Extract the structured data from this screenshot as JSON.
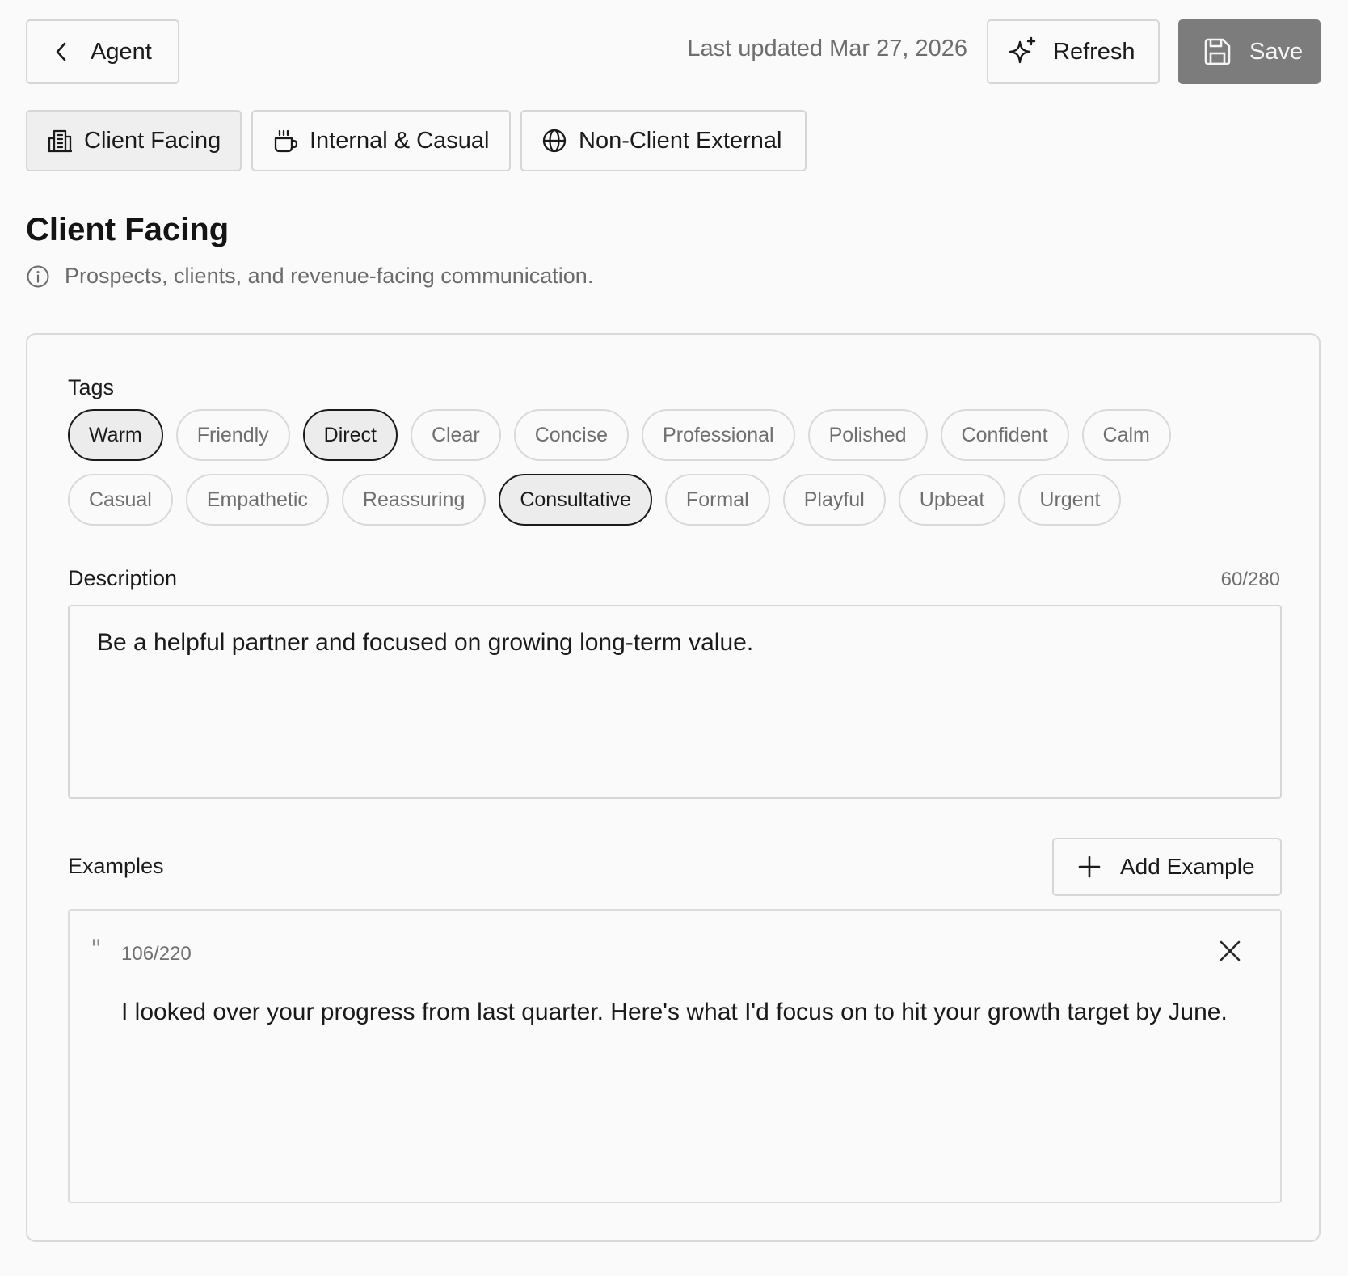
{
  "header": {
    "back_label": "Agent",
    "last_updated": "Last updated Mar 27, 2026",
    "refresh_label": "Refresh",
    "save_label": "Save"
  },
  "tabs": [
    {
      "label": "Client Facing",
      "icon": "building-icon",
      "active": true
    },
    {
      "label": "Internal & Casual",
      "icon": "coffee-cup-icon",
      "active": false
    },
    {
      "label": "Non-Client External",
      "icon": "globe-icon",
      "active": false
    }
  ],
  "section": {
    "title": "Client Facing",
    "subtitle": "Prospects, clients, and revenue-facing communication."
  },
  "tags": {
    "label": "Tags",
    "rows": [
      [
        {
          "label": "Warm",
          "selected": true
        },
        {
          "label": "Friendly",
          "selected": false
        },
        {
          "label": "Direct",
          "selected": true
        },
        {
          "label": "Clear",
          "selected": false
        },
        {
          "label": "Concise",
          "selected": false
        },
        {
          "label": "Professional",
          "selected": false
        },
        {
          "label": "Polished",
          "selected": false
        },
        {
          "label": "Confident",
          "selected": false
        },
        {
          "label": "Calm",
          "selected": false
        }
      ],
      [
        {
          "label": "Casual",
          "selected": false
        },
        {
          "label": "Empathetic",
          "selected": false
        },
        {
          "label": "Reassuring",
          "selected": false
        },
        {
          "label": "Consultative",
          "selected": true
        },
        {
          "label": "Formal",
          "selected": false
        },
        {
          "label": "Playful",
          "selected": false
        },
        {
          "label": "Upbeat",
          "selected": false
        },
        {
          "label": "Urgent",
          "selected": false
        }
      ]
    ]
  },
  "description": {
    "label": "Description",
    "count": "60/280",
    "value": "Be a helpful partner and focused on growing long-term value."
  },
  "examples": {
    "label": "Examples",
    "add_label": "Add Example",
    "items": [
      {
        "count": "106/220",
        "text": "I looked over your progress from last quarter. Here's what I'd focus on to hit your growth target by June."
      }
    ]
  },
  "colors": {
    "background": "#fafafa",
    "border": "#d6d6d6",
    "save_button": "#7c7c7c",
    "selected_tag_bg": "#ececec",
    "muted_text": "#6f6f6f"
  }
}
